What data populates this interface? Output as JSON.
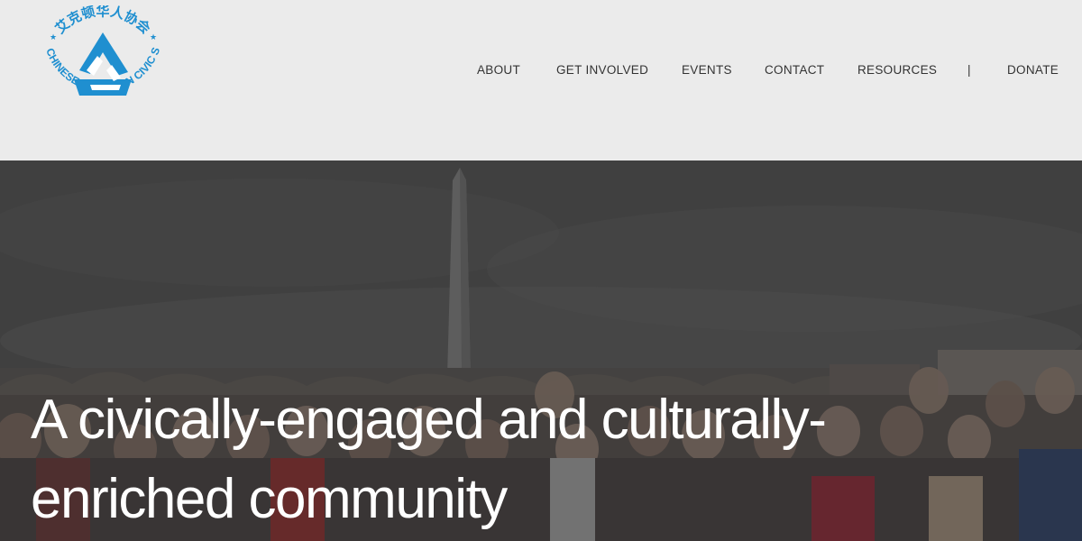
{
  "logo": {
    "chinese_text": "艾克顿华人协会",
    "english_text": "ACTON CHINESE AMERICAN CIVIC SOCIETY",
    "brand_color": "#1f8fd0"
  },
  "nav": {
    "items": [
      {
        "label": "ABOUT"
      },
      {
        "label": "GET INVOLVED"
      },
      {
        "label": "EVENTS"
      },
      {
        "label": "CONTACT"
      },
      {
        "label": "RESOURCES"
      },
      {
        "label": "|"
      },
      {
        "label": "DONATE"
      }
    ]
  },
  "hero": {
    "headline_line1": "A civically-engaged and culturally-",
    "headline_line2": "enriched community",
    "photo_subject": "group-photo-washington-monument"
  }
}
